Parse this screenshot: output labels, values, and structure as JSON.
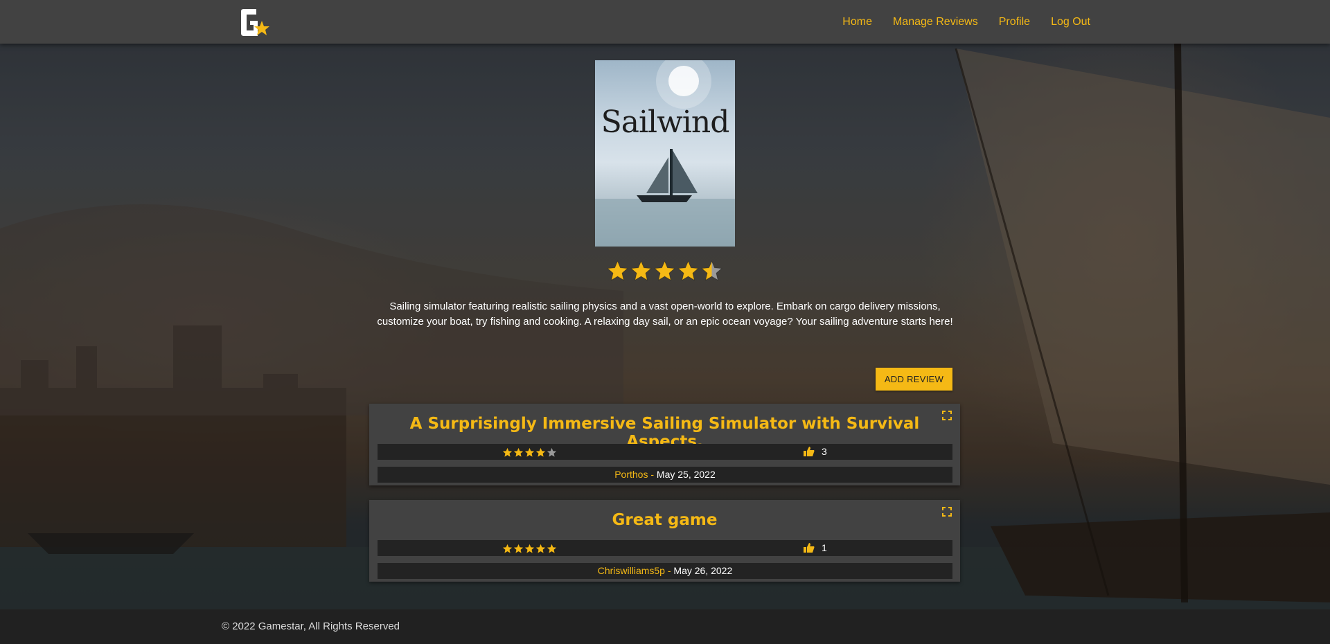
{
  "nav": {
    "links": [
      "Home",
      "Manage Reviews",
      "Profile",
      "Log Out"
    ]
  },
  "game": {
    "cover_title": "Sailwind",
    "rating": 4.5,
    "description": "Sailing simulator featuring realistic sailing physics and a vast open-world to explore. Embark on cargo delivery missions, customize your boat, try fishing and cooking. A relaxing day sail, or an epic ocean voyage? Your sailing adventure starts here!"
  },
  "add_review_label": "ADD REVIEW",
  "reviews": [
    {
      "title": "A Surprisingly Immersive Sailing Simulator with Survival Aspects.",
      "stars": 4,
      "likes": "3",
      "author": "Porthos",
      "separator": " - ",
      "date": "May 25, 2022"
    },
    {
      "title": "Great game",
      "stars": 5,
      "likes": "1",
      "author": "Chriswilliams5p",
      "separator": " - ",
      "date": "May 26, 2022"
    }
  ],
  "footer": {
    "text": "© 2022 Gamestar, All Rights Reserved"
  },
  "colors": {
    "accent": "#f5b915",
    "nav_bg": "#424242",
    "card_bg": "#424242",
    "bar_bg": "#232323",
    "footer_bg": "#212121",
    "star_empty": "#9a9a9a"
  },
  "icons": {
    "logo": "gamestar-logo",
    "star": "star-icon",
    "like": "thumbs-up-icon",
    "expand": "expand-icon"
  }
}
